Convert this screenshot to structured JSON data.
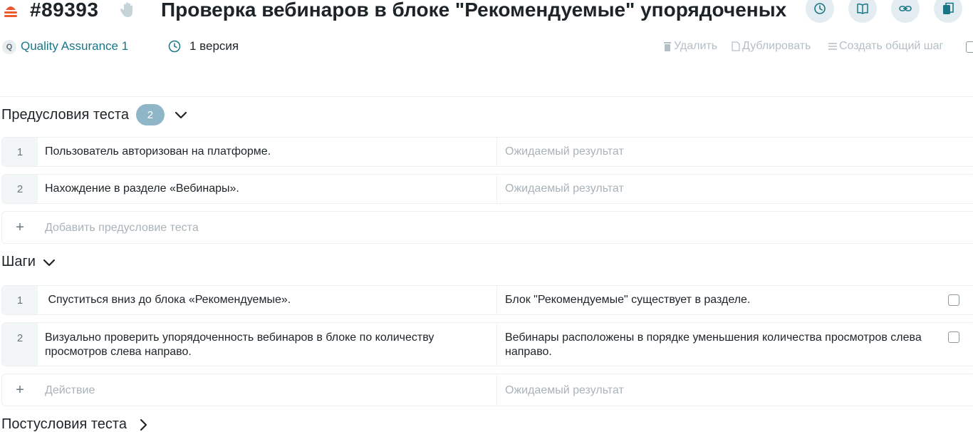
{
  "header": {
    "priority_icon": "priority-high-icon",
    "case_id": "#89393",
    "hand_icon": "manual-hand-icon",
    "title": "Проверка вебинаров в блоке \"Рекомендуемые\" упорядоченых по",
    "buttons": [
      "history-icon",
      "book-icon",
      "link-icon",
      "copy-icon"
    ],
    "accent_color": "#1a7687",
    "button_bg": "#e3edf1"
  },
  "meta": {
    "project_badge": "Q",
    "project_name": "Quality Assurance 1",
    "version": "1 версия",
    "actions": {
      "delete": "Удалить",
      "duplicate": "Дублировать",
      "create_shared_step": "Создать общий шаг"
    }
  },
  "preconditions": {
    "title": "Предусловия теста",
    "count": "2",
    "rows": [
      {
        "num": "1",
        "action": "Пользователь авторизован на платформе.",
        "result_placeholder": "Ожидаемый результат"
      },
      {
        "num": "2",
        "action": "Нахождение в разделе «Вебинары».",
        "result_placeholder": "Ожидаемый результат"
      }
    ],
    "add_plus": "+",
    "add_placeholder": "Добавить предусловие теста"
  },
  "steps": {
    "title": "Шаги",
    "rows": [
      {
        "num": "1",
        "action": " Спуститься вниз до блока «Рекомендуемые».",
        "result": "Блок \"Рекомендуемые\" существует в разделе."
      },
      {
        "num": "2",
        "action": "Визуально проверить упорядоченность вебинаров в блоке по количеству просмотров слева направо.",
        "result": "Вебинары расположены в порядке уменьшения количества просмотров слева направо."
      }
    ],
    "add_plus": "+",
    "action_placeholder": "Действие",
    "result_placeholder": "Ожидаемый результат"
  },
  "postconditions": {
    "title": "Постусловия теста"
  }
}
